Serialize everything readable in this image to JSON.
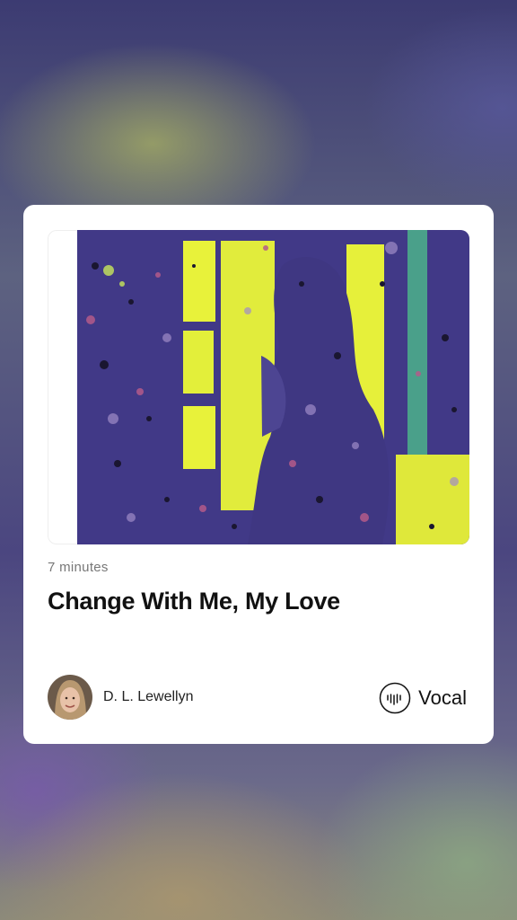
{
  "story_card": {
    "read_time": "7 minutes",
    "title": "Change With Me, My Love",
    "author": {
      "name": "D. L. Lewellyn",
      "avatar": "author-photo"
    },
    "platform": {
      "name": "Vocal",
      "icon": "vocal-logo-icon"
    },
    "cover_image": "abstract-painting-figure-at-window"
  },
  "colors": {
    "card_bg": "#ffffff",
    "title": "#111111",
    "read_time": "#777777",
    "art_purple": "#463f8f",
    "art_yellow": "#e8f23a"
  }
}
